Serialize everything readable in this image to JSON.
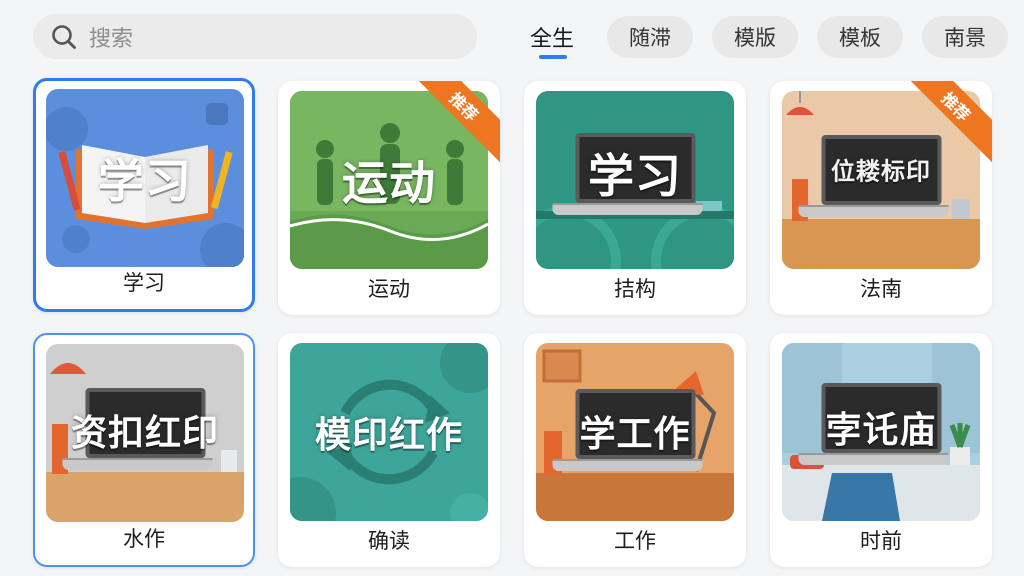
{
  "search": {
    "placeholder": "搜索"
  },
  "tabs": {
    "active": "全生",
    "pills": [
      "随滞",
      "模版",
      "模板",
      "南景"
    ]
  },
  "cards": [
    {
      "thumb_title": "学习",
      "label": "学习",
      "badge": ""
    },
    {
      "thumb_title": "运动",
      "label": "运动",
      "badge": "推荐"
    },
    {
      "thumb_title": "学习",
      "label": "拮构",
      "badge": ""
    },
    {
      "thumb_title": "位耧标印",
      "label": "法南",
      "badge": "推荐"
    },
    {
      "thumb_title": "资扣红印",
      "label": "水作",
      "badge": ""
    },
    {
      "thumb_title": "模印红作",
      "label": "确读",
      "badge": ""
    },
    {
      "thumb_title": "学工作",
      "label": "工作",
      "badge": ""
    },
    {
      "thumb_title": "孛讬庙",
      "label": "时前",
      "badge": ""
    }
  ],
  "colors": {
    "accent": "#2f7bf0",
    "ribbon": "#ee7621",
    "thumb_blue": "#5b8fdd",
    "thumb_green": "#6aaa55",
    "thumb_teal": "#2f9683",
    "thumb_peach": "#e9c9a8",
    "thumb_grey": "#cfcfcf",
    "thumb_teal2": "#3ea59a",
    "thumb_orange": "#e6a36a",
    "thumb_sky": "#a9cfe0"
  },
  "icons": {
    "search": "search-icon"
  }
}
